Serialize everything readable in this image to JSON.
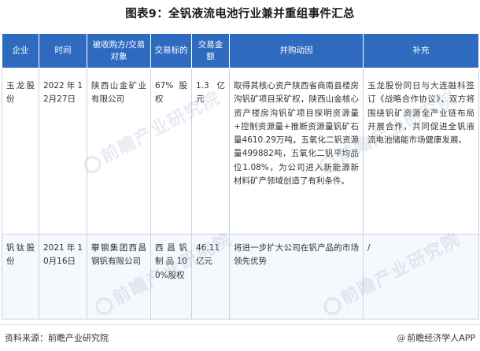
{
  "title": "图表9：全钒液流电池行业兼并重组事件汇总",
  "table": {
    "headers": [
      "企业",
      "时间",
      "被收购方/交易对象",
      "交易标的",
      "交易金额",
      "并购动因",
      "补充"
    ],
    "rows": [
      [
        "玉龙股份",
        "2022年12月27日",
        "陕西山金矿业有限公司",
        "67%股权",
        "1.3亿元",
        "取得其核心资产陕西省商南县楼房沟钒矿项目采矿权，陕西山金核心资产楼房沟钒矿项目探明资源量+控制资源量+推断资源量钒矿石量4610.29万吨，五氧化二钒资源量499882吨，五氧化二钒平均品位1.08%，为公司进入新能源新材料矿产领域创造了有利条件。",
        "玉龙股份同日与大连融科签订《战略合作协议》，双方将围绕钒矿资源全产业链布局开展合作，共同促进全钒液流电池储能市场健康发展。"
      ],
      [
        "钒钛股份",
        "2021年10月16日",
        "攀钢集团西昌钢钒有限公司",
        "西昌钒制品100%股权",
        "46.11亿元",
        "将进一步扩大公司在钒产品的市场领先优势",
        "/"
      ]
    ]
  },
  "watermark": "前瞻产业研究院",
  "footer": {
    "source": "资料来源：前瞻产业研究院",
    "credit": "前瞻经济学人APP",
    "credit_icon": "weibo-icon"
  },
  "colors": {
    "header_bg": "#2e6bbf",
    "header_text": "#ffffff",
    "border": "#c9d3e1"
  }
}
